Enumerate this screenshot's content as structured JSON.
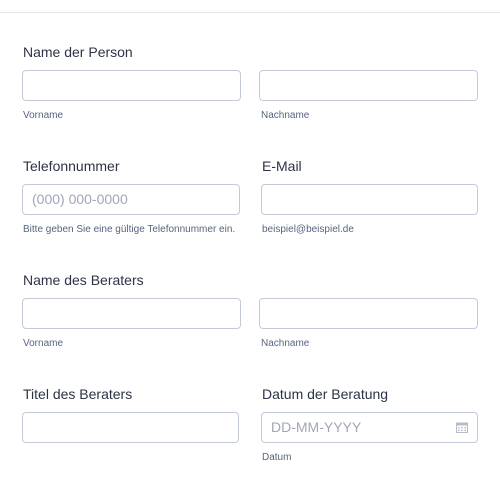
{
  "sections": [
    {
      "label": "Name der Person",
      "fields": [
        {
          "value": "",
          "placeholder": "",
          "sublabel": "Vorname"
        },
        {
          "value": "",
          "placeholder": "",
          "sublabel": "Nachname"
        }
      ]
    },
    {
      "labels": [
        "Telefonnummer",
        "E-Mail"
      ],
      "fields": [
        {
          "value": "",
          "placeholder": "(000) 000-0000",
          "sublabel": "Bitte geben Sie eine gültige Telefonnummer ein."
        },
        {
          "value": "",
          "placeholder": "",
          "sublabel": "beispiel@beispiel.de"
        }
      ]
    },
    {
      "label": "Name des Beraters",
      "fields": [
        {
          "value": "",
          "placeholder": "",
          "sublabel": "Vorname"
        },
        {
          "value": "",
          "placeholder": "",
          "sublabel": "Nachname"
        }
      ]
    },
    {
      "labels": [
        "Titel des Beraters",
        "Datum der Beratung"
      ],
      "fields": [
        {
          "value": "",
          "placeholder": "",
          "sublabel": ""
        },
        {
          "value": "",
          "placeholder": "DD-MM-YYYY",
          "sublabel": "Datum",
          "icon": "calendar-icon"
        }
      ]
    }
  ]
}
